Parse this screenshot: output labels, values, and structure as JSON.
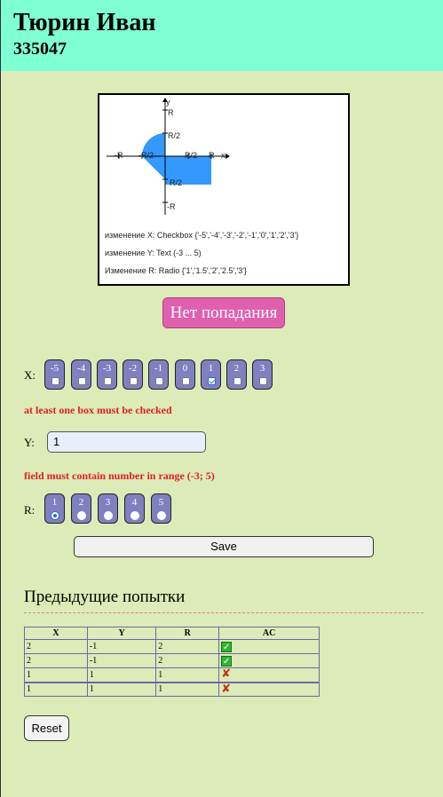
{
  "header": {
    "name": "Тюрин Иван",
    "id": "335047"
  },
  "plot": {
    "labels": {
      "y": "y",
      "x": "x",
      "r": "R",
      "r_half": "R/2",
      "neg_r": "-R",
      "neg_r_half": "-R/2"
    },
    "fill_color": "#3399ff",
    "hints": [
      "изменение X: Checkbox {'-5','-4','-3','-2','-1','0','1','2','3'}",
      "изменение Y: Text (-3 ... 5)",
      "Изменение R: Radio {'1','1.5','2','2.5','3'}"
    ]
  },
  "result": {
    "label": "Нет попадания",
    "color": "#e060b0"
  },
  "x_field": {
    "label": "X:",
    "options": [
      "-5",
      "-4",
      "-3",
      "-2",
      "-1",
      "0",
      "1",
      "2",
      "3"
    ],
    "checked": "1",
    "error": "at least one box must be checked"
  },
  "y_field": {
    "label": "Y:",
    "value": "1",
    "error": "field must contain number in range (-3; 5)"
  },
  "r_field": {
    "label": "R:",
    "options": [
      "1",
      "2",
      "3",
      "4",
      "5"
    ],
    "selected": "1"
  },
  "save_label": "Save",
  "history": {
    "title": "Предыдущие попытки",
    "columns": [
      "X",
      "Y",
      "R",
      "AC"
    ],
    "rows": [
      {
        "x": "2",
        "y": "-1",
        "r": "2",
        "ac": "check-icon"
      },
      {
        "x": "2",
        "y": "-1",
        "r": "2",
        "ac": "check-icon"
      },
      {
        "x": "1",
        "y": "1",
        "r": "1",
        "ac": "cross-icon"
      },
      {
        "x": "1",
        "y": "1",
        "r": "1",
        "ac": "cross-icon"
      }
    ]
  },
  "reset_label": "Reset"
}
